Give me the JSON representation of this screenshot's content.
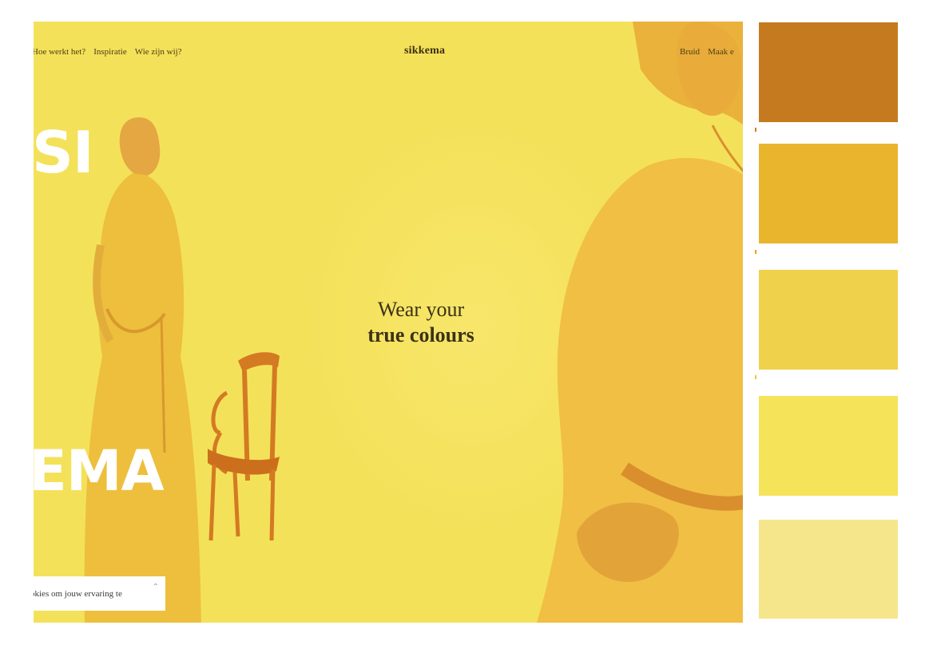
{
  "nav": {
    "left": [
      "Hoe werkt het?",
      "Inspiratie",
      "Wie zijn wij?"
    ],
    "logo": "sikkema",
    "right": [
      "Bruid",
      "Maak e"
    ]
  },
  "hero": {
    "big_top": "SI",
    "big_bottom": "EMA",
    "headline_line1": "Wear your",
    "headline_line2": "true colours"
  },
  "cookie": {
    "text": "okies om jouw ervaring te",
    "close_icon": "chevron-up-icon"
  },
  "palette": {
    "colors": [
      "#c67a1f",
      "#e8b52d",
      "#f0d14c",
      "#f5e35a",
      "#f6e68b"
    ]
  },
  "theme": {
    "background": "#f4e15a",
    "accent": "#e07a10"
  }
}
